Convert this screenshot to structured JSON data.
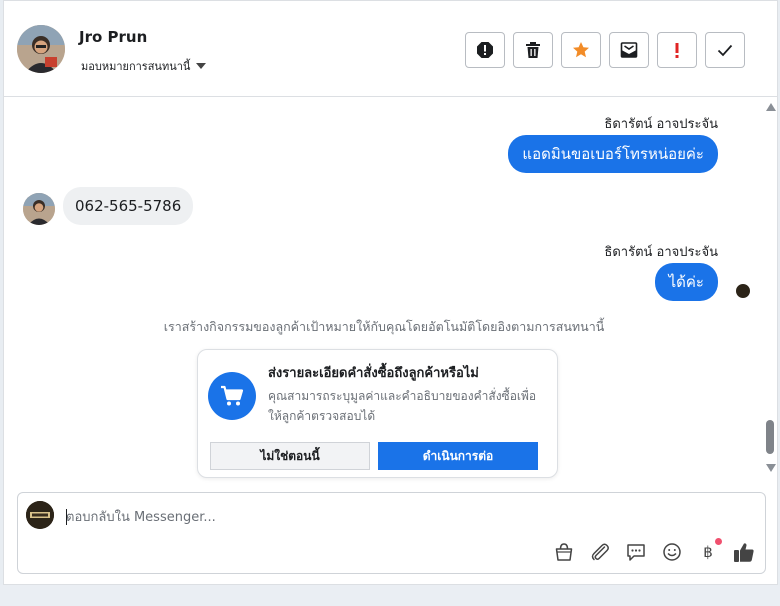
{
  "header": {
    "contact_name": "Jro Prun",
    "assign_label": "มอบหมายการสนทนานี้",
    "toolbar": [
      {
        "name": "spam-icon"
      },
      {
        "name": "trash-icon"
      },
      {
        "name": "star-icon"
      },
      {
        "name": "mark-unread-icon"
      },
      {
        "name": "important-icon"
      },
      {
        "name": "done-icon"
      }
    ]
  },
  "colors": {
    "accent": "#1a73e8",
    "star": "#f28c28",
    "alert": "#e02424",
    "notification_dot": "#f0506e"
  },
  "thread": {
    "messages": [
      {
        "from": "page",
        "sender": "ธิดารัตน์ อาจประจัน",
        "text": "แอดมินขอเบอร์โทรหน่อยค่ะ"
      },
      {
        "from": "customer",
        "text": "062-565-5786"
      },
      {
        "from": "page",
        "sender": "ธิดารัตน์ อาจประจัน",
        "text": "ได้ค่ะ"
      }
    ],
    "system_note": "เราสร้างกิจกรรมของลูกค้าเป้าหมายให้กับคุณโดยอัตโนมัติโดยอิงตามการสนทนานี้"
  },
  "order_card": {
    "title": "ส่งรายละเอียดคำสั่งซื้อถึงลูกค้าหรือไม่",
    "description": "คุณสามารถระบุมูลค่าและคำอธิบายของคำสั่งซื้อเพื่อให้ลูกค้าตรวจสอบได้",
    "secondary_label": "ไม่ใช่ตอนนี้",
    "primary_label": "ดำเนินการต่อ"
  },
  "composer": {
    "placeholder": "ตอบกลับใน Messenger...",
    "icons": [
      "shopping-bag-icon",
      "attachment-icon",
      "saved-reply-icon",
      "emoji-icon",
      "baht-payment-icon",
      "like-icon"
    ],
    "baht_symbol": "฿"
  }
}
